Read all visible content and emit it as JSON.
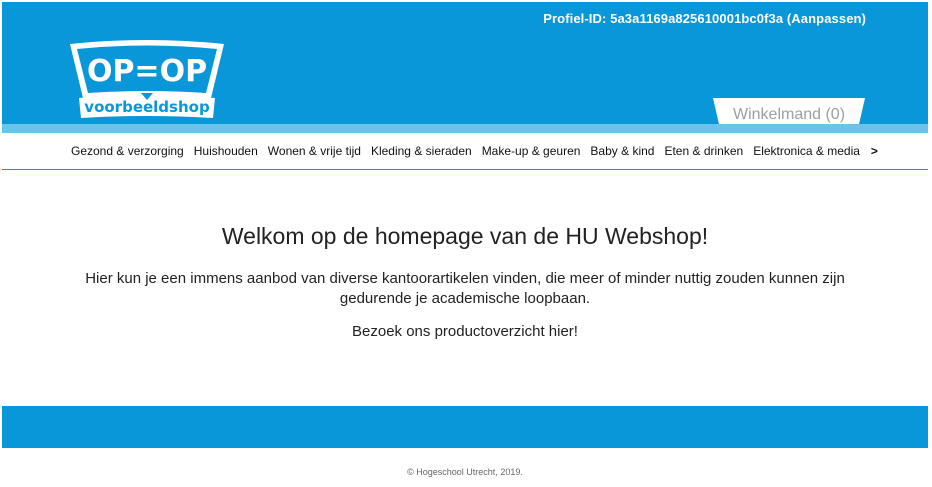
{
  "header": {
    "profile_text": "Profiel-ID: 5a3a1169a825610001bc0f3a",
    "profile_action": "(Aanpassen)",
    "logo": {
      "top_text": "OP=OP",
      "bottom_text": "voorbeeldshop"
    },
    "cart_label": "Winkelmand (0)",
    "colors": {
      "brand_blue": "#0a97d9",
      "stripe_blue": "#6cc3ea"
    }
  },
  "nav": {
    "items": [
      {
        "label": "Gezond & verzorging"
      },
      {
        "label": "Huishouden"
      },
      {
        "label": "Wonen & vrije tijd"
      },
      {
        "label": "Kleding & sieraden"
      },
      {
        "label": "Make-up & geuren"
      },
      {
        "label": "Baby & kind"
      },
      {
        "label": "Eten & drinken"
      },
      {
        "label": "Elektronica & media"
      }
    ],
    "more_label": ">"
  },
  "main": {
    "heading": "Welkom op de homepage van de HU Webshop!",
    "intro": "Hier kun je een immens aanbod van diverse kantoorartikelen vinden, die meer of minder nuttig zouden kunnen zijn gedurende je academische loopbaan.",
    "cta": "Bezoek ons productoverzicht hier!"
  },
  "footer": {
    "copyright": "© Hogeschool Utrecht, 2019."
  }
}
